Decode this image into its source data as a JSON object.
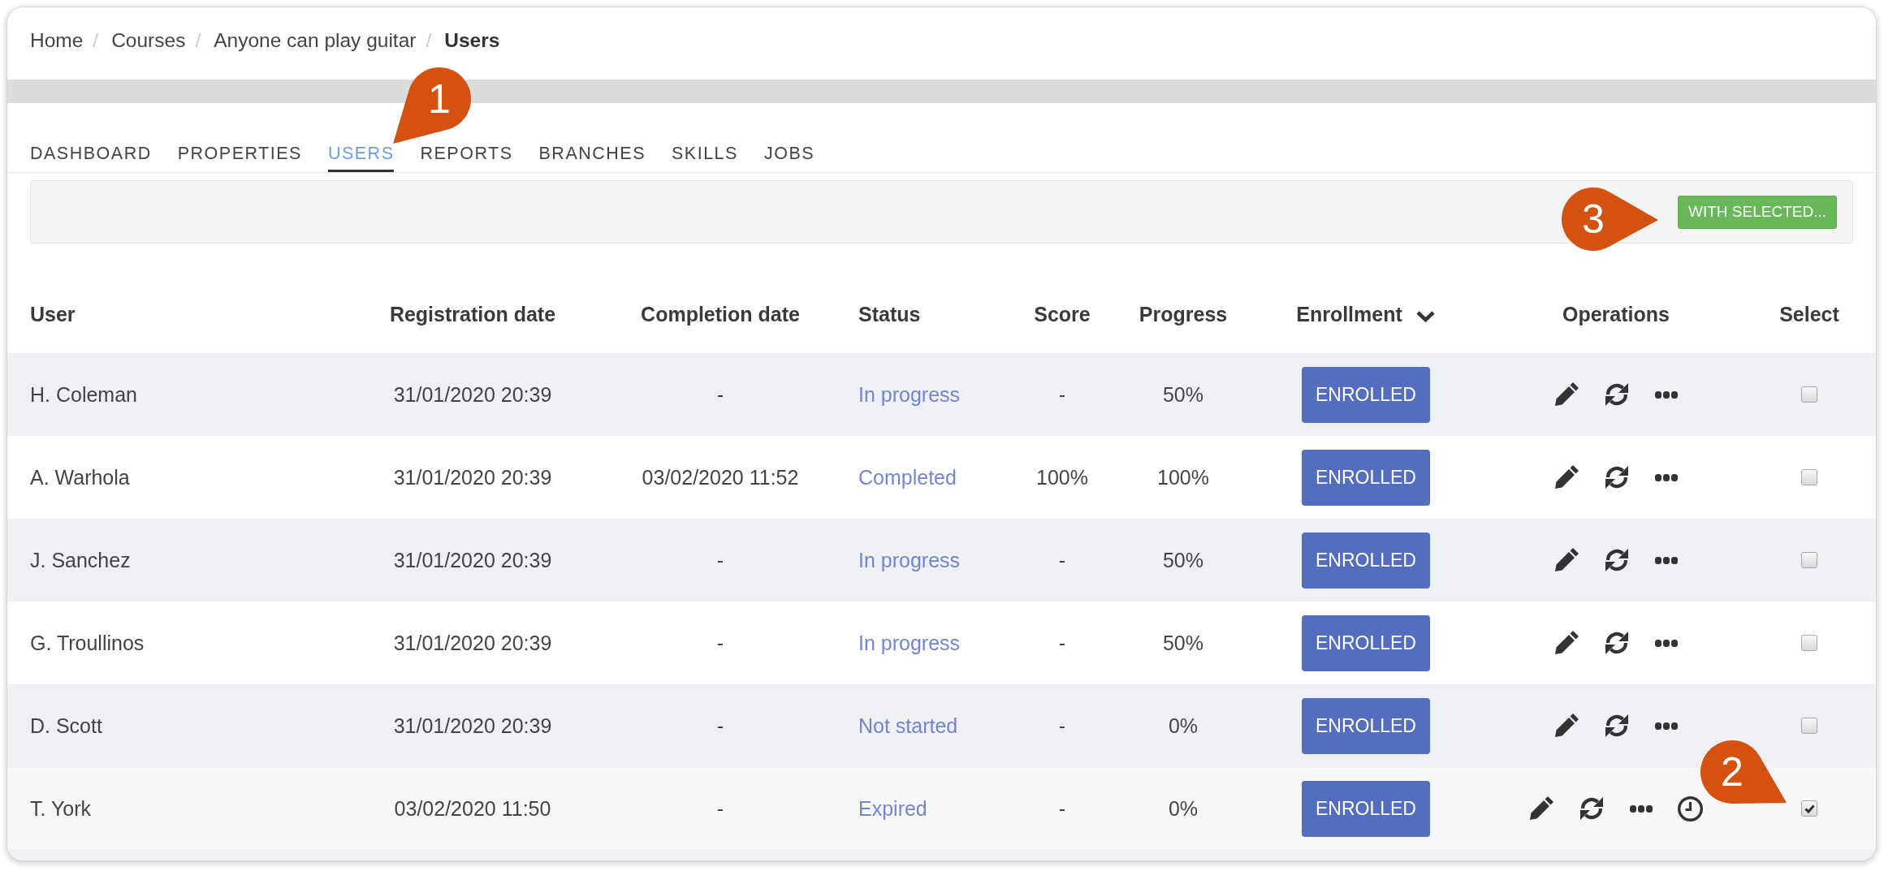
{
  "breadcrumb": [
    {
      "label": "Home",
      "current": false,
      "separator": "/"
    },
    {
      "label": "Courses",
      "current": false,
      "separator": "/"
    },
    {
      "label": "Anyone can play guitar",
      "current": false,
      "separator": "/"
    },
    {
      "label": "Users",
      "current": true
    }
  ],
  "tabs": [
    {
      "label": "DASHBOARD",
      "selected": false
    },
    {
      "label": "PROPERTIES",
      "selected": false
    },
    {
      "label": "USERS",
      "selected": true
    },
    {
      "label": "REPORTS",
      "selected": false
    },
    {
      "label": "BRANCHES",
      "selected": false
    },
    {
      "label": "SKILLS",
      "selected": false
    },
    {
      "label": "JOBS",
      "selected": false
    }
  ],
  "toolbar": {
    "button": "WITH SELECTED..."
  },
  "table": {
    "columns": [
      {
        "label": "User",
        "sorted": false
      },
      {
        "label": "Registration date",
        "sorted": false
      },
      {
        "label": "Completion date",
        "sorted": false
      },
      {
        "label": "Status",
        "sorted": false
      },
      {
        "label": "Score",
        "sorted": false
      },
      {
        "label": "Progress",
        "sorted": false
      },
      {
        "label": "Enrollment",
        "sorted": true
      },
      {
        "label": "Operations",
        "sorted": false
      },
      {
        "label": "Select",
        "sorted": false
      }
    ],
    "rows": [
      {
        "user": "H. Coleman",
        "registration_date": "31/01/2020 20:39",
        "completion_date": "-",
        "status": "In progress",
        "score": "-",
        "progress": "50%",
        "enrollment": "ENROLLED",
        "operations": [
          {
            "kind": "edit"
          },
          {
            "kind": "reset"
          },
          {
            "kind": "more"
          }
        ],
        "checked": false
      },
      {
        "user": "A. Warhola",
        "registration_date": "31/01/2020 20:39",
        "completion_date": "03/02/2020 11:52",
        "status": "Completed",
        "score": "100%",
        "progress": "100%",
        "enrollment": "ENROLLED",
        "operations": [
          {
            "kind": "edit"
          },
          {
            "kind": "reset"
          },
          {
            "kind": "more"
          }
        ],
        "checked": false
      },
      {
        "user": "J. Sanchez",
        "registration_date": "31/01/2020 20:39",
        "completion_date": "-",
        "status": "In progress",
        "score": "-",
        "progress": "50%",
        "enrollment": "ENROLLED",
        "operations": [
          {
            "kind": "edit"
          },
          {
            "kind": "reset"
          },
          {
            "kind": "more"
          }
        ],
        "checked": false
      },
      {
        "user": "G. Troullinos",
        "registration_date": "31/01/2020 20:39",
        "completion_date": "-",
        "status": "In progress",
        "score": "-",
        "progress": "50%",
        "enrollment": "ENROLLED",
        "operations": [
          {
            "kind": "edit"
          },
          {
            "kind": "reset"
          },
          {
            "kind": "more"
          }
        ],
        "checked": false
      },
      {
        "user": "D. Scott",
        "registration_date": "31/01/2020 20:39",
        "completion_date": "-",
        "status": "Not started",
        "score": "-",
        "progress": "0%",
        "enrollment": "ENROLLED",
        "operations": [
          {
            "kind": "edit"
          },
          {
            "kind": "reset"
          },
          {
            "kind": "more"
          }
        ],
        "checked": false
      },
      {
        "user": "T. York",
        "registration_date": "03/02/2020 11:50",
        "completion_date": "-",
        "status": "Expired",
        "score": "-",
        "progress": "0%",
        "enrollment": "ENROLLED",
        "operations": [
          {
            "kind": "edit"
          },
          {
            "kind": "reset"
          },
          {
            "kind": "more"
          },
          {
            "kind": "time"
          }
        ],
        "checked": true
      }
    ]
  },
  "callouts": [
    {
      "label": "1"
    },
    {
      "label": "2"
    },
    {
      "label": "3"
    }
  ]
}
